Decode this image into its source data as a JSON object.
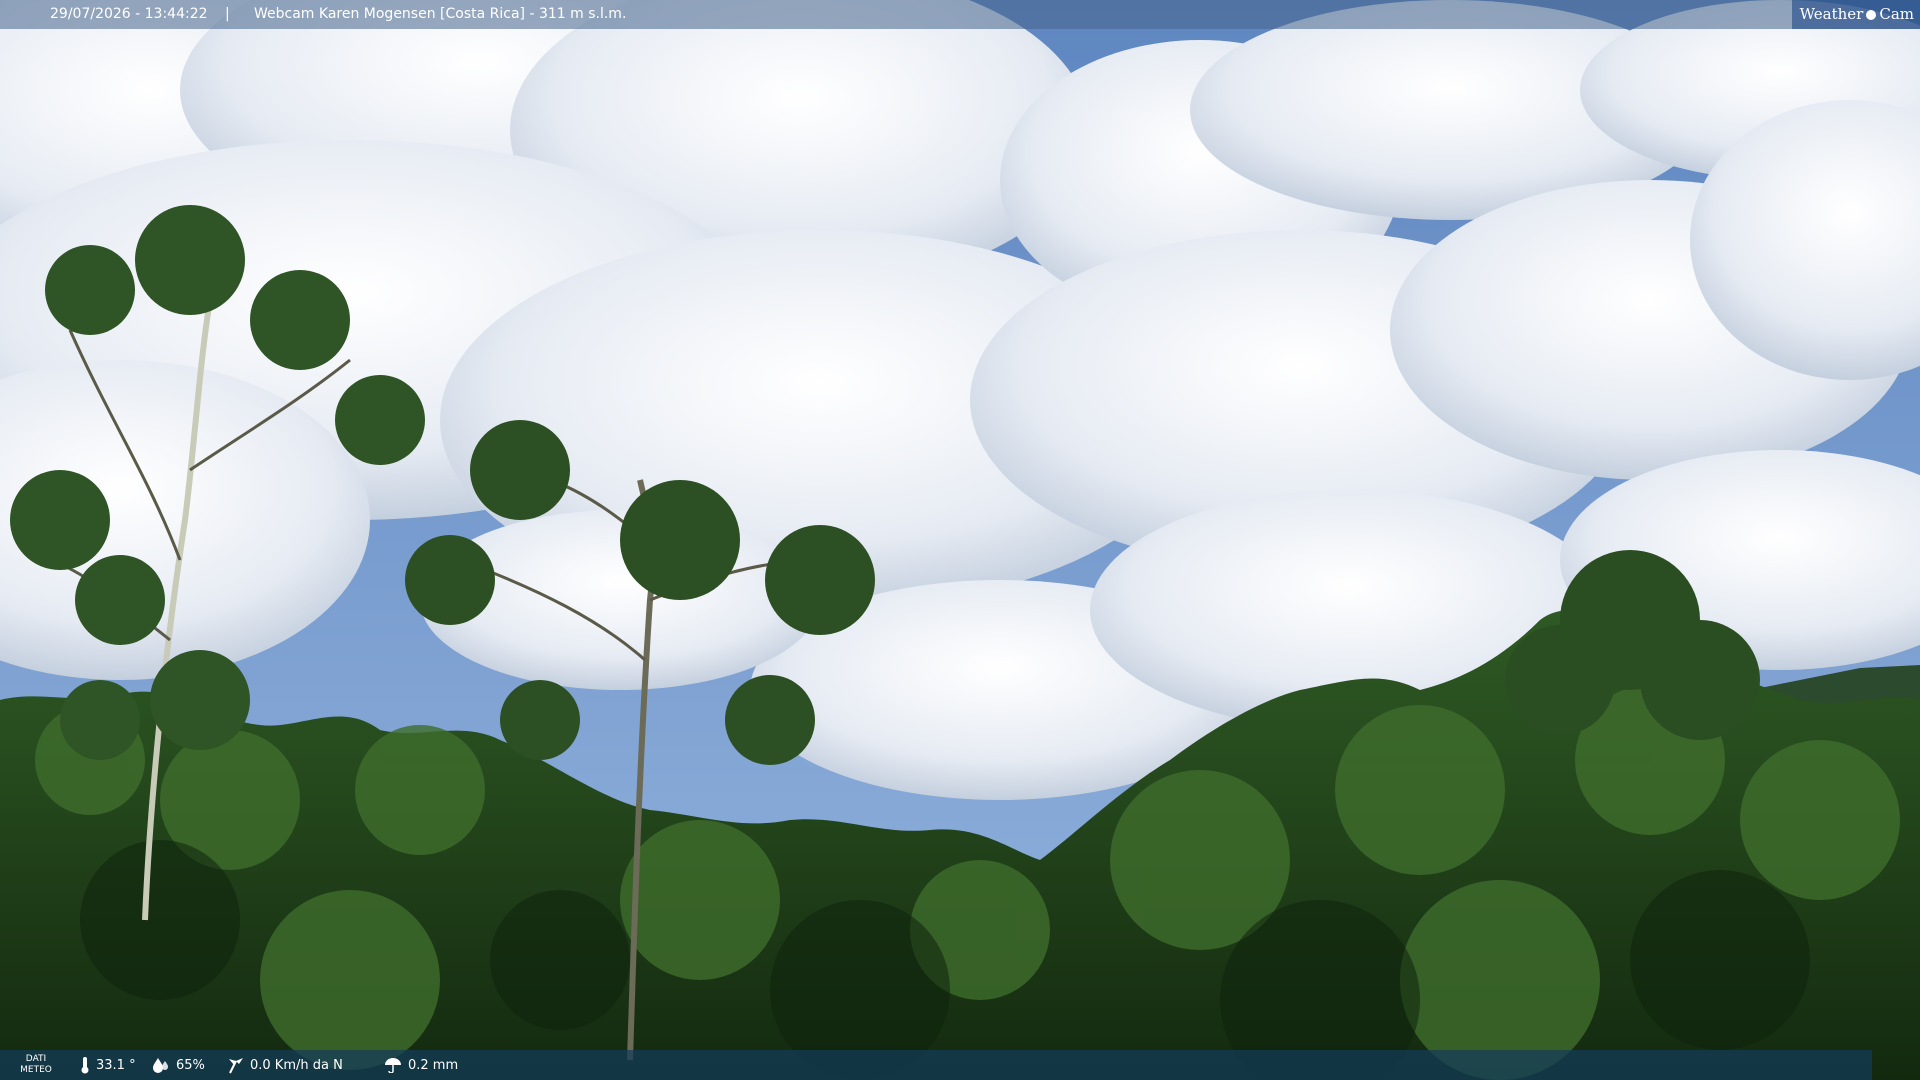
{
  "header": {
    "datetime": "29/07/2026 - 13:44:22",
    "separator": "|",
    "webcam_title": "Webcam Karen Mogensen [Costa Rica]  - 311 m s.l.m.",
    "brand": {
      "left": "Weather",
      "right": "Cam"
    }
  },
  "weather_bar": {
    "label_line1": "DATI",
    "label_line2": "METEO",
    "temperature": "33.1 °",
    "humidity": "65%",
    "wind": "0.0 Km/h da N",
    "rain": "0.2 mm"
  },
  "icons": {
    "temperature": "thermometer-icon",
    "humidity": "droplet-icon",
    "wind": "wind-icon",
    "rain": "rain-icon"
  },
  "colors": {
    "sky": "#6f93c8",
    "cloud": "#eef2f8",
    "forest_dark": "#1c3a18",
    "forest_light": "#3b6a2a"
  }
}
